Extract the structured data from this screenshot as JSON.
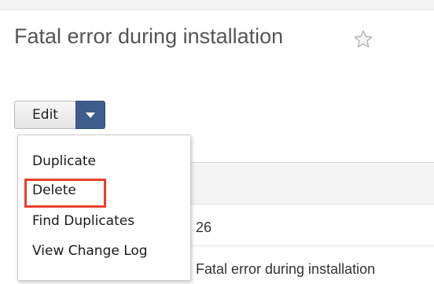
{
  "page": {
    "title": "Fatal error during installation"
  },
  "toolbar": {
    "edit_label": "Edit",
    "dropdown_icon": "caret-down-icon",
    "favorite_icon": "star-outline-icon"
  },
  "action_menu": {
    "items": [
      {
        "label": "Duplicate"
      },
      {
        "label": "Delete",
        "highlighted": true
      },
      {
        "label": "Find Duplicates"
      },
      {
        "label": "View Change Log"
      }
    ]
  },
  "record": {
    "number": "26",
    "name": "Fatal error during installation"
  },
  "colors": {
    "toggle_accent": "#3f5c8d",
    "highlight": "#e8412c",
    "title_text": "#555555"
  }
}
